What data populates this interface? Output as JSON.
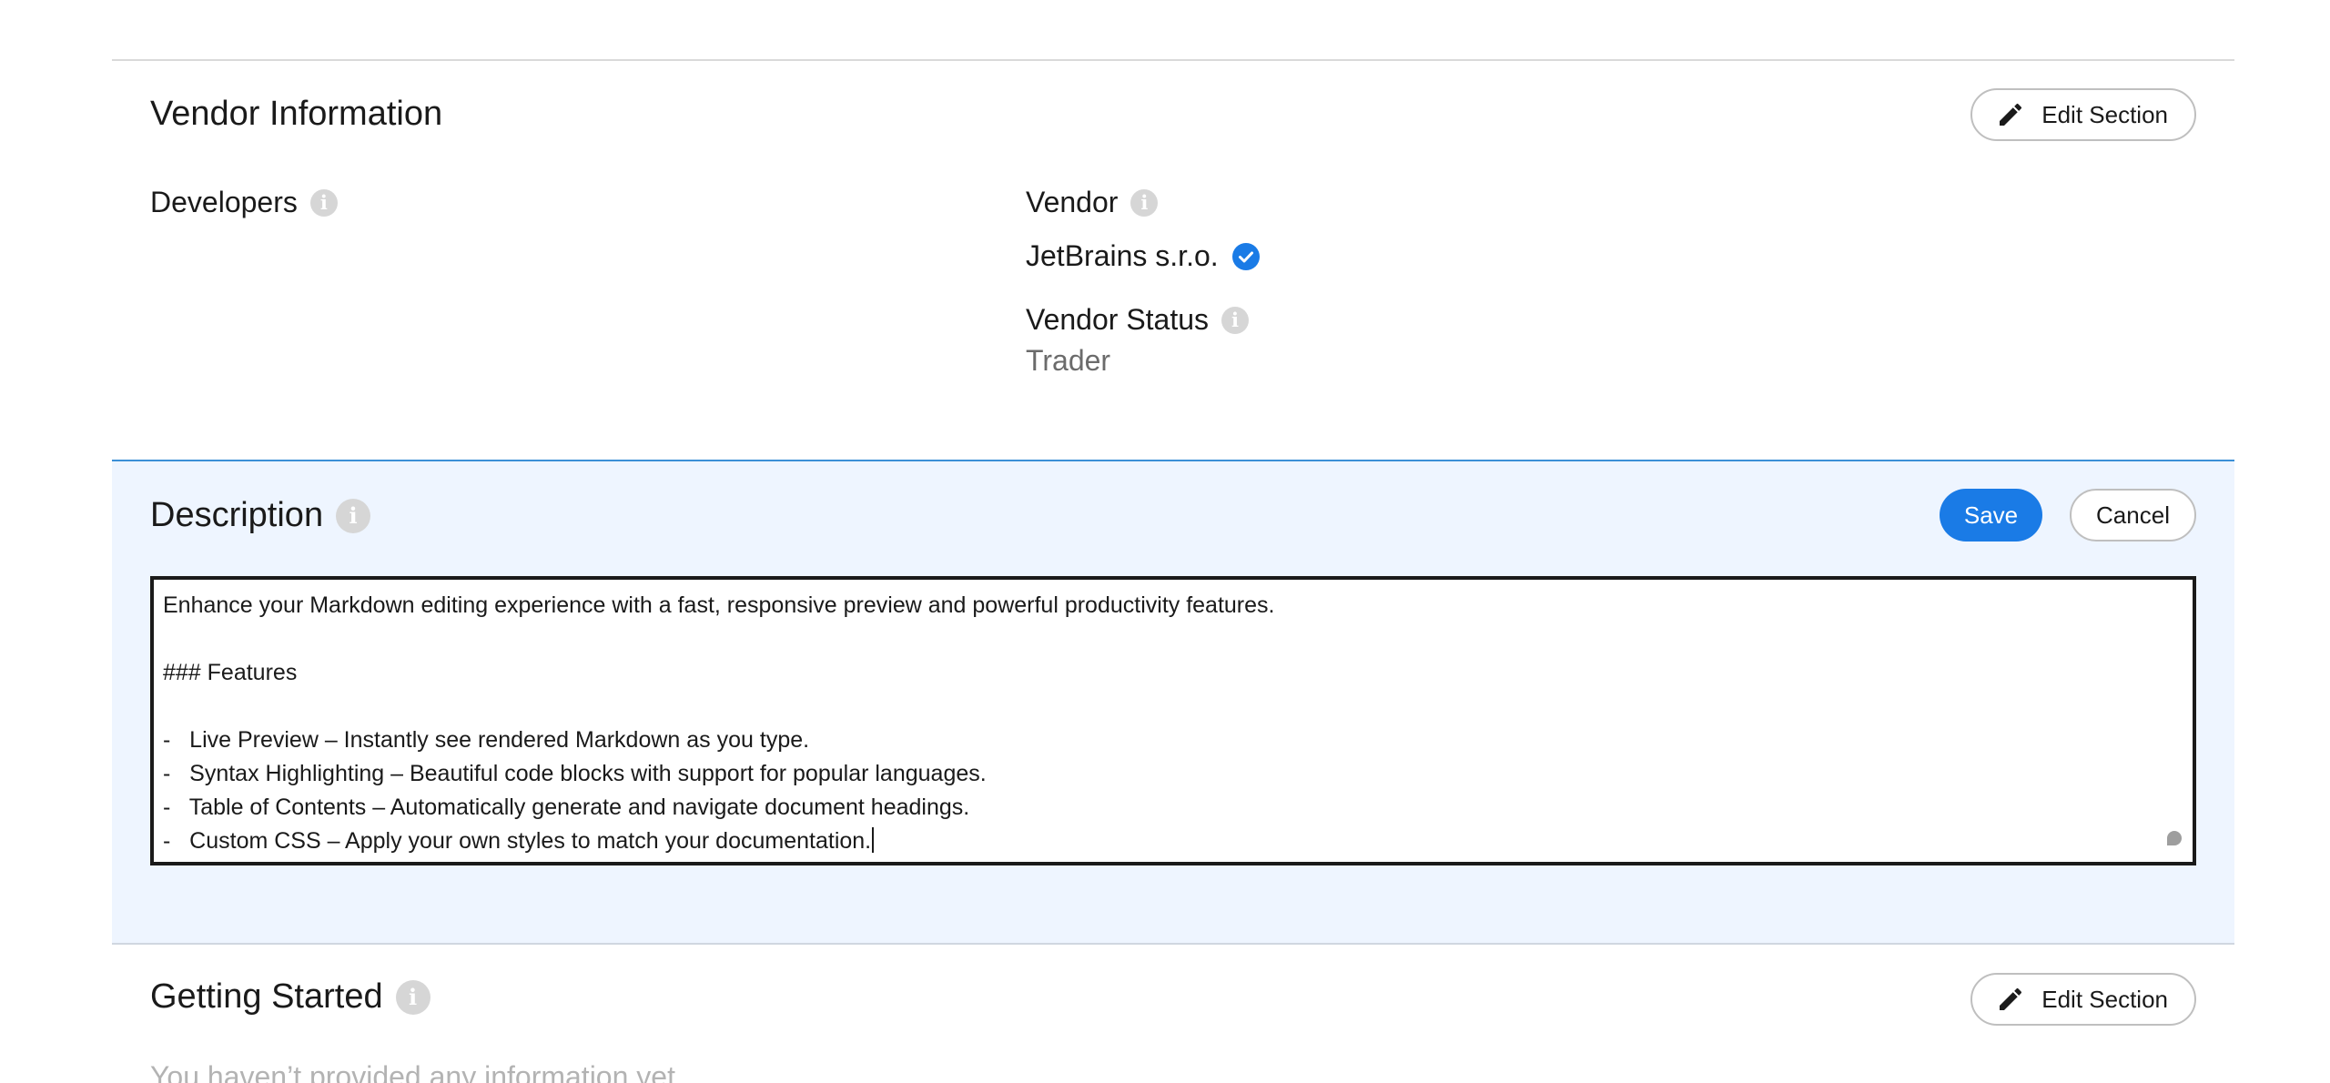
{
  "vendor_section": {
    "title": "Vendor Information",
    "edit_label": "Edit Section",
    "developers_label": "Developers",
    "vendor_label": "Vendor",
    "vendor_name": "JetBrains s.r.o.",
    "vendor_status_label": "Vendor Status",
    "vendor_status_value": "Trader"
  },
  "description_section": {
    "title": "Description",
    "save_label": "Save",
    "cancel_label": "Cancel",
    "editor_lines": [
      "Enhance your Markdown editing experience with a fast, responsive preview and powerful productivity features.",
      "",
      "### Features",
      "",
      "-   Live Preview – Instantly see rendered Markdown as you type.",
      "-   Syntax Highlighting – Beautiful code blocks with support for popular languages.",
      "-   Table of Contents – Automatically generate and navigate document headings.",
      "-   Custom CSS – Apply your own styles to match your documentation."
    ]
  },
  "getting_started_section": {
    "title": "Getting Started",
    "edit_label": "Edit Section",
    "empty_text": "You haven’t provided any information yet"
  },
  "colors": {
    "accent": "#1a7be6",
    "panel_bg": "#eef5ff",
    "verified": "#1a7be6",
    "muted_text": "#6b6b6b",
    "info_icon": "#d6d6d6"
  },
  "icons": [
    "pencil-icon",
    "info-icon",
    "verified-check-icon",
    "resize-handle-icon"
  ]
}
